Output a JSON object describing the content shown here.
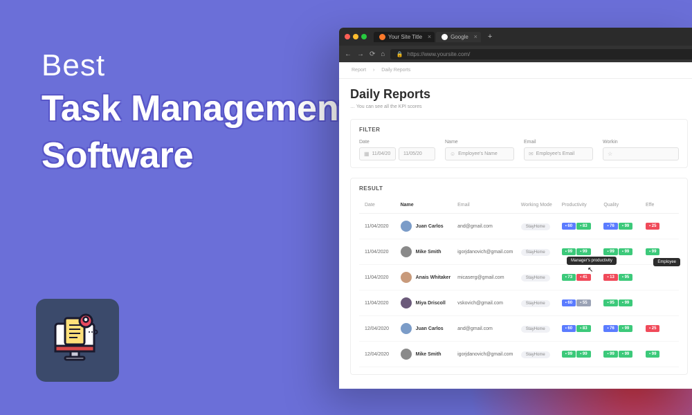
{
  "hero": {
    "line1": "Best",
    "line2": "Task Management",
    "line3": "Software"
  },
  "browser": {
    "tabs": [
      {
        "title": "Your Site Title",
        "favicon": "#ff7a2b"
      },
      {
        "title": "Google",
        "favicon": "#fff"
      }
    ],
    "url": "https://www.yoursite.com/",
    "breadcrumb": [
      "Report",
      "Daily Reports"
    ],
    "page_title": "Daily Reports",
    "page_sub": "… You can see all the KPI scores",
    "filter": {
      "title": "FILTER",
      "date": {
        "label": "Date",
        "from": "11/04/20",
        "to": "11/05/20"
      },
      "name": {
        "label": "Name",
        "placeholder": "Employee's Name"
      },
      "email": {
        "label": "Email",
        "placeholder": "Employee's Email"
      },
      "mode": {
        "label": "Workin"
      }
    },
    "result": {
      "title": "RESULT",
      "columns": [
        "Date",
        "Name",
        "Email",
        "Working Mode",
        "Productivity",
        "Quality",
        "Effe"
      ],
      "rows": [
        {
          "date": "11/04/2020",
          "name": "Juan Carlos",
          "email": "and@gmail.com",
          "mode": "StayHome",
          "prod": [
            {
              "v": 60,
              "c": "b"
            },
            {
              "v": 83,
              "c": "g"
            }
          ],
          "qual": [
            {
              "v": 76,
              "c": "b"
            },
            {
              "v": 99,
              "c": "g"
            }
          ],
          "eff": [
            {
              "v": 25,
              "c": "r"
            }
          ],
          "avatar": "#7b9cc8"
        },
        {
          "date": "11/04/2020",
          "name": "Mike Smith",
          "email": "igorjdanovich@gmail.com",
          "mode": "StayHome",
          "prod": [
            {
              "v": 99,
              "c": "g"
            },
            {
              "v": 99,
              "c": "g"
            }
          ],
          "qual": [
            {
              "v": 99,
              "c": "g"
            },
            {
              "v": 99,
              "c": "g"
            }
          ],
          "eff": [
            {
              "v": 99,
              "c": "g"
            }
          ],
          "avatar": "#8a8a8a"
        },
        {
          "date": "11/04/2020",
          "name": "Anais Whitaker",
          "email": "micaserg@gmail.com",
          "mode": "StayHome",
          "prod": [
            {
              "v": 73,
              "c": "g"
            },
            {
              "v": 41,
              "c": "r"
            }
          ],
          "qual": [
            {
              "v": 13,
              "c": "r"
            },
            {
              "v": 95,
              "c": "g"
            }
          ],
          "eff": [],
          "avatar": "#c89a7b",
          "tip1": "Manager's productivity",
          "tip2": "Employee",
          "cursor": true
        },
        {
          "date": "11/04/2020",
          "name": "Miya Driscoll",
          "email": "vskovich@gmail.com",
          "mode": "StayHome",
          "prod": [
            {
              "v": 60,
              "c": "b"
            },
            {
              "v": 55,
              "c": "gy"
            }
          ],
          "qual": [
            {
              "v": 95,
              "c": "g"
            },
            {
              "v": 99,
              "c": "g"
            }
          ],
          "eff": [],
          "avatar": "#6b5a7a"
        },
        {
          "date": "12/04/2020",
          "name": "Juan Carlos",
          "email": "and@gmail.com",
          "mode": "StayHome",
          "prod": [
            {
              "v": 60,
              "c": "b"
            },
            {
              "v": 83,
              "c": "g"
            }
          ],
          "qual": [
            {
              "v": 76,
              "c": "b"
            },
            {
              "v": 99,
              "c": "g"
            }
          ],
          "eff": [
            {
              "v": 25,
              "c": "r"
            }
          ],
          "avatar": "#7b9cc8"
        },
        {
          "date": "12/04/2020",
          "name": "Mike Smith",
          "email": "igorjdanovich@gmail.com",
          "mode": "StayHome",
          "prod": [
            {
              "v": 99,
              "c": "g"
            },
            {
              "v": 99,
              "c": "g"
            }
          ],
          "qual": [
            {
              "v": 99,
              "c": "g"
            },
            {
              "v": 99,
              "c": "g"
            }
          ],
          "eff": [
            {
              "v": 99,
              "c": "g"
            }
          ],
          "avatar": "#8a8a8a"
        }
      ]
    }
  }
}
